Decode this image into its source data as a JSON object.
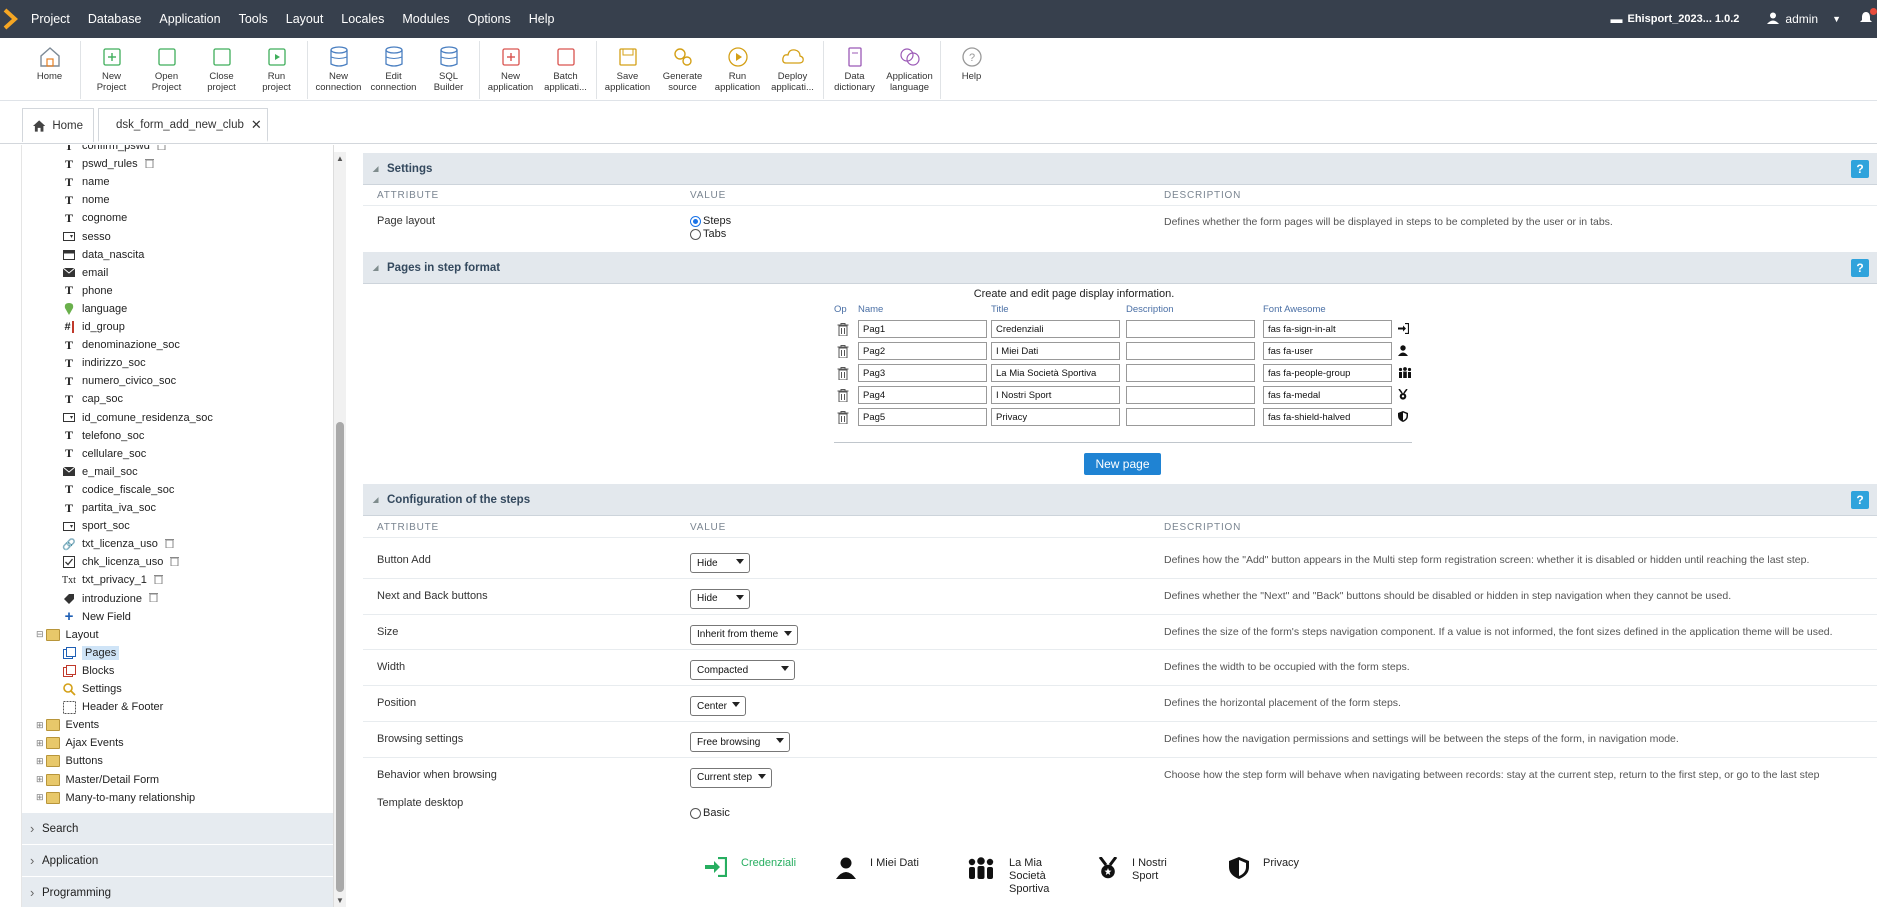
{
  "menubar": {
    "items": [
      "Project",
      "Database",
      "Application",
      "Tools",
      "Layout",
      "Locales",
      "Modules",
      "Options",
      "Help"
    ],
    "project": "Ehisport_2023... 1.0.2",
    "user": "admin"
  },
  "toolbar": {
    "groups": [
      [
        {
          "label": "Home",
          "icon": "home-icon"
        }
      ],
      [
        {
          "label": "New\nProject",
          "icon": "new-project-icon"
        },
        {
          "label": "Open\nProject",
          "icon": "open-project-icon"
        },
        {
          "label": "Close\nproject",
          "icon": "close-project-icon"
        },
        {
          "label": "Run\nproject",
          "icon": "run-project-icon"
        }
      ],
      [
        {
          "label": "New\nconnection",
          "icon": "new-connection-icon"
        },
        {
          "label": "Edit\nconnection",
          "icon": "edit-connection-icon"
        },
        {
          "label": "SQL\nBuilder",
          "icon": "sql-builder-icon"
        }
      ],
      [
        {
          "label": "New\napplication",
          "icon": "new-application-icon"
        },
        {
          "label": "Batch\napplicati...",
          "icon": "batch-application-icon"
        }
      ],
      [
        {
          "label": "Save\napplication",
          "icon": "save-icon"
        },
        {
          "label": "Generate\nsource",
          "icon": "generate-source-icon"
        },
        {
          "label": "Run\napplication",
          "icon": "run-application-icon"
        },
        {
          "label": "Deploy\napplicati...",
          "icon": "deploy-icon"
        }
      ],
      [
        {
          "label": "Data\ndictionary",
          "icon": "data-dictionary-icon"
        },
        {
          "label": "Application\nlanguage",
          "icon": "language-icon"
        }
      ],
      [
        {
          "label": "Help",
          "icon": "help-icon"
        }
      ]
    ]
  },
  "tabs": {
    "home": "Home",
    "form": "dsk_form_add_new_club"
  },
  "tree": {
    "fields": [
      {
        "label": "confirm_pswd",
        "icon": "T"
      },
      {
        "label": "pswd_rules",
        "icon": "T"
      },
      {
        "label": "name",
        "icon": "T"
      },
      {
        "label": "nome",
        "icon": "T"
      },
      {
        "label": "cognome",
        "icon": "T"
      },
      {
        "label": "sesso",
        "icon": "sel"
      },
      {
        "label": "data_nascita",
        "icon": "cal"
      },
      {
        "label": "email",
        "icon": "mail"
      },
      {
        "label": "phone",
        "icon": "T"
      },
      {
        "label": "language",
        "icon": "pin"
      },
      {
        "label": "id_group",
        "icon": "#"
      },
      {
        "label": "denominazione_soc",
        "icon": "T"
      },
      {
        "label": "indirizzo_soc",
        "icon": "T"
      },
      {
        "label": "numero_civico_soc",
        "icon": "T"
      },
      {
        "label": "cap_soc",
        "icon": "T"
      },
      {
        "label": "id_comune_residenza_soc",
        "icon": "sel"
      },
      {
        "label": "telefono_soc",
        "icon": "T"
      },
      {
        "label": "cellulare_soc",
        "icon": "T"
      },
      {
        "label": "e_mail_soc",
        "icon": "mail"
      },
      {
        "label": "codice_fiscale_soc",
        "icon": "T"
      },
      {
        "label": "partita_iva_soc",
        "icon": "T"
      },
      {
        "label": "sport_soc",
        "icon": "sel"
      },
      {
        "label": "txt_licenza_uso",
        "icon": "link"
      },
      {
        "label": "chk_licenza_uso",
        "icon": "chk"
      },
      {
        "label": "txt_privacy_1",
        "icon": "txt"
      },
      {
        "label": "introduzione",
        "icon": "tag"
      },
      {
        "label": "New Field",
        "icon": "plus"
      }
    ],
    "layout": "Layout",
    "layout_items": [
      "Pages",
      "Blocks",
      "Settings",
      "Header & Footer"
    ],
    "folders": [
      "Events",
      "Ajax Events",
      "Buttons",
      "Master/Detail Form",
      "Many-to-many relationship"
    ],
    "accordions": [
      "Search",
      "Application",
      "Programming"
    ]
  },
  "settings": {
    "title": "Settings",
    "hdr_attribute": "ATTRIBUTE",
    "hdr_value": "VALUE",
    "hdr_description": "DESCRIPTION",
    "page_layout_label": "Page layout",
    "opt_steps": "Steps",
    "opt_tabs": "Tabs",
    "page_layout_desc": "Defines whether the form pages will be displayed in steps to be completed by the user or in tabs."
  },
  "pages": {
    "title": "Pages in step format",
    "caption": "Create and edit page display information.",
    "cols": [
      "Op",
      "Name",
      "Title",
      "Description",
      "Font Awesome"
    ],
    "rows": [
      {
        "name": "Pag1",
        "title": "Credenziali",
        "description": "",
        "fa": "fas fa-sign-in-alt",
        "icon": "sign-in-icon"
      },
      {
        "name": "Pag2",
        "title": "I Miei Dati",
        "description": "",
        "fa": "fas fa-user",
        "icon": "user-icon"
      },
      {
        "name": "Pag3",
        "title": "La Mia Società Sportiva",
        "description": "",
        "fa": "fas fa-people-group",
        "icon": "people-group-icon"
      },
      {
        "name": "Pag4",
        "title": "I Nostri Sport",
        "description": "",
        "fa": "fas fa-medal",
        "icon": "medal-icon"
      },
      {
        "name": "Pag5",
        "title": "Privacy",
        "description": "",
        "fa": "fas fa-shield-halved",
        "icon": "shield-icon"
      }
    ],
    "new_page": "New page"
  },
  "config": {
    "title": "Configuration of the steps",
    "rows": [
      {
        "label": "Button Add",
        "value": "Hide",
        "desc": "Defines how the \"Add\" button appears in the Multi step form registration screen: whether it is disabled or hidden until reaching the last step."
      },
      {
        "label": "Next and Back buttons",
        "value": "Hide",
        "desc": "Defines whether the \"Next\" and \"Back\" buttons should be disabled or hidden in step navigation when they cannot be used."
      },
      {
        "label": "Size",
        "value": "Inherit from theme",
        "desc": "Defines the size of the form's steps navigation component. If a value is not informed, the font sizes defined in the application theme will be used."
      },
      {
        "label": "Width",
        "value": "Compacted",
        "desc": "Defines the width to be occupied with the form steps."
      },
      {
        "label": "Position",
        "value": "Center",
        "desc": "Defines the horizontal placement of the form steps."
      },
      {
        "label": "Browsing settings",
        "value": "Free browsing",
        "desc": "Defines how the navigation permissions and settings will be between the steps of the form, in navigation mode."
      },
      {
        "label": "Behavior when browsing",
        "value": "Current step",
        "desc": "Choose how the step form will behave when navigating between records: stay at the current step, return to the first step, or go to the last step"
      }
    ],
    "template_label": "Template desktop",
    "template_value": "Basic"
  },
  "preview": {
    "steps": [
      {
        "label": "Credenziali",
        "icon": "sign-in-icon",
        "active": true
      },
      {
        "label": "I Miei Dati",
        "icon": "user-icon",
        "active": false
      },
      {
        "label": "La Mia\nSocietà\nSportiva",
        "icon": "people-group-icon",
        "active": false
      },
      {
        "label": "I Nostri\nSport",
        "icon": "medal-icon",
        "active": false
      },
      {
        "label": "Privacy",
        "icon": "shield-icon",
        "active": false
      }
    ],
    "active_color": "#27ae60"
  },
  "colors": {
    "menubar": "#37404d",
    "accent": "#1f83d3",
    "help": "#2fa3dc",
    "section": "#e3e8ed"
  }
}
